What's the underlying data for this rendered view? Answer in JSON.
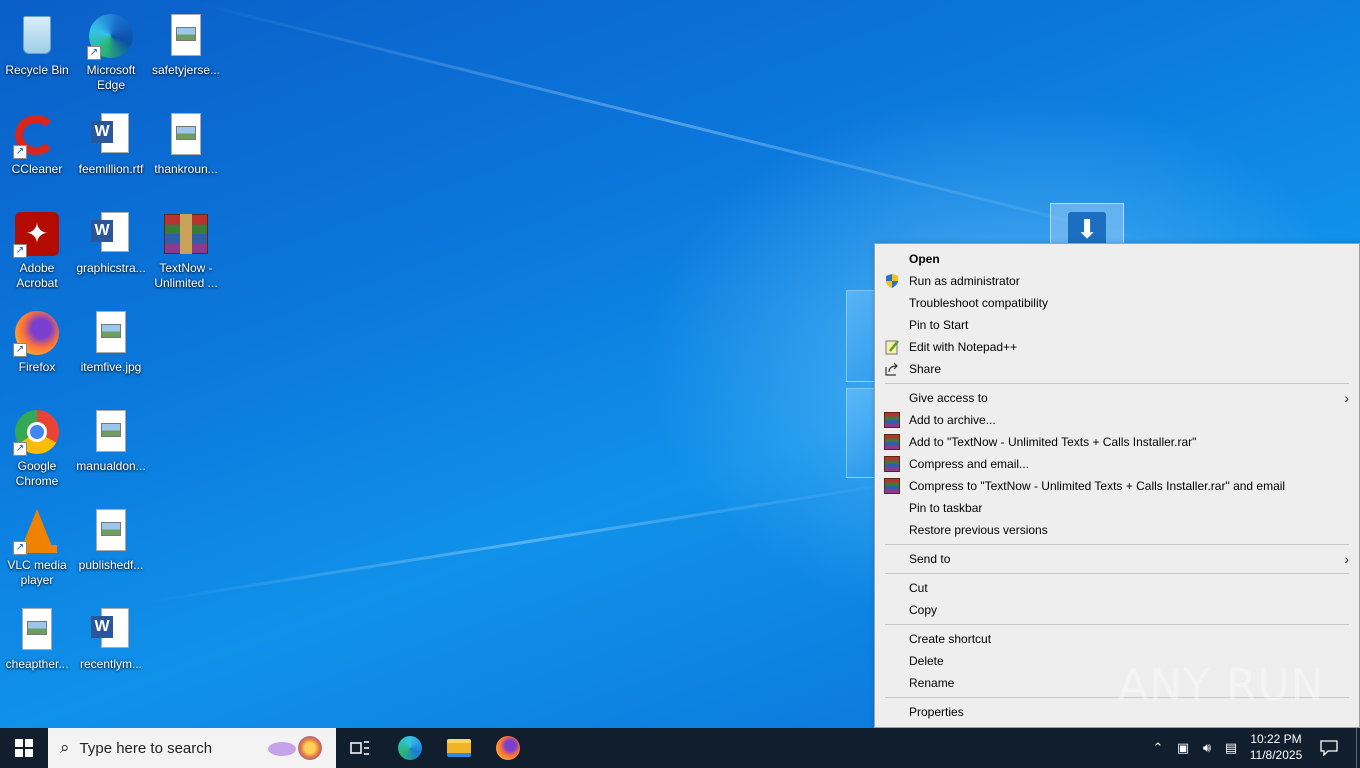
{
  "desktop": {
    "icons": [
      {
        "label": "Recycle Bin",
        "icon": "recycle-bin-icon"
      },
      {
        "label": "Microsoft Edge",
        "icon": "edge-icon"
      },
      {
        "label": "safetyjerse...",
        "icon": "image-file-icon"
      },
      {
        "label": "CCleaner",
        "icon": "ccleaner-icon"
      },
      {
        "label": "feemillion.rtf",
        "icon": "word-doc-icon"
      },
      {
        "label": "thankroun...",
        "icon": "image-file-icon"
      },
      {
        "label": "Adobe Acrobat",
        "icon": "acrobat-icon"
      },
      {
        "label": "graphicstra...",
        "icon": "word-doc-icon"
      },
      {
        "label": "TextNow - Unlimited ...",
        "icon": "winrar-icon"
      },
      {
        "label": "Firefox",
        "icon": "firefox-icon"
      },
      {
        "label": "itemfive.jpg",
        "icon": "image-file-icon"
      },
      {
        "label": "Google Chrome",
        "icon": "chrome-icon"
      },
      {
        "label": "manualdon...",
        "icon": "image-file-icon"
      },
      {
        "label": "VLC media player",
        "icon": "vlc-icon"
      },
      {
        "label": "publishedf...",
        "icon": "image-file-icon"
      },
      {
        "label": "cheapther...",
        "icon": "image-file-icon"
      },
      {
        "label": "recentlym...",
        "icon": "word-doc-icon"
      }
    ]
  },
  "context_menu": {
    "groups": [
      [
        {
          "label": "Open",
          "bold": true,
          "icon": ""
        },
        {
          "label": "Run as administrator",
          "icon": "shield-icon"
        },
        {
          "label": "Troubleshoot compatibility",
          "icon": ""
        },
        {
          "label": "Pin to Start",
          "icon": ""
        },
        {
          "label": "Edit with Notepad++",
          "icon": "notepadpp-icon"
        },
        {
          "label": "Share",
          "icon": "share-icon"
        }
      ],
      [
        {
          "label": "Give access to",
          "icon": "",
          "submenu": true
        },
        {
          "label": "Add to archive...",
          "icon": "winrar-icon"
        },
        {
          "label": "Add to \"TextNow - Unlimited Texts + Calls Installer.rar\"",
          "icon": "winrar-icon"
        },
        {
          "label": "Compress and email...",
          "icon": "winrar-icon"
        },
        {
          "label": "Compress to \"TextNow - Unlimited Texts + Calls Installer.rar\" and email",
          "icon": "winrar-icon"
        },
        {
          "label": "Pin to taskbar",
          "icon": ""
        },
        {
          "label": "Restore previous versions",
          "icon": ""
        }
      ],
      [
        {
          "label": "Send to",
          "icon": "",
          "submenu": true
        }
      ],
      [
        {
          "label": "Cut",
          "icon": ""
        },
        {
          "label": "Copy",
          "icon": ""
        }
      ],
      [
        {
          "label": "Create shortcut",
          "icon": ""
        },
        {
          "label": "Delete",
          "icon": ""
        },
        {
          "label": "Rename",
          "icon": ""
        }
      ],
      [
        {
          "label": "Properties",
          "icon": ""
        }
      ]
    ]
  },
  "taskbar": {
    "search_placeholder": "Type here to search",
    "pinned": [
      "task-view-icon",
      "edge-icon",
      "file-explorer-icon",
      "firefox-icon"
    ],
    "clock_time": "10:22 PM",
    "clock_date": "11/8/2025"
  },
  "watermark": "ANY RUN"
}
